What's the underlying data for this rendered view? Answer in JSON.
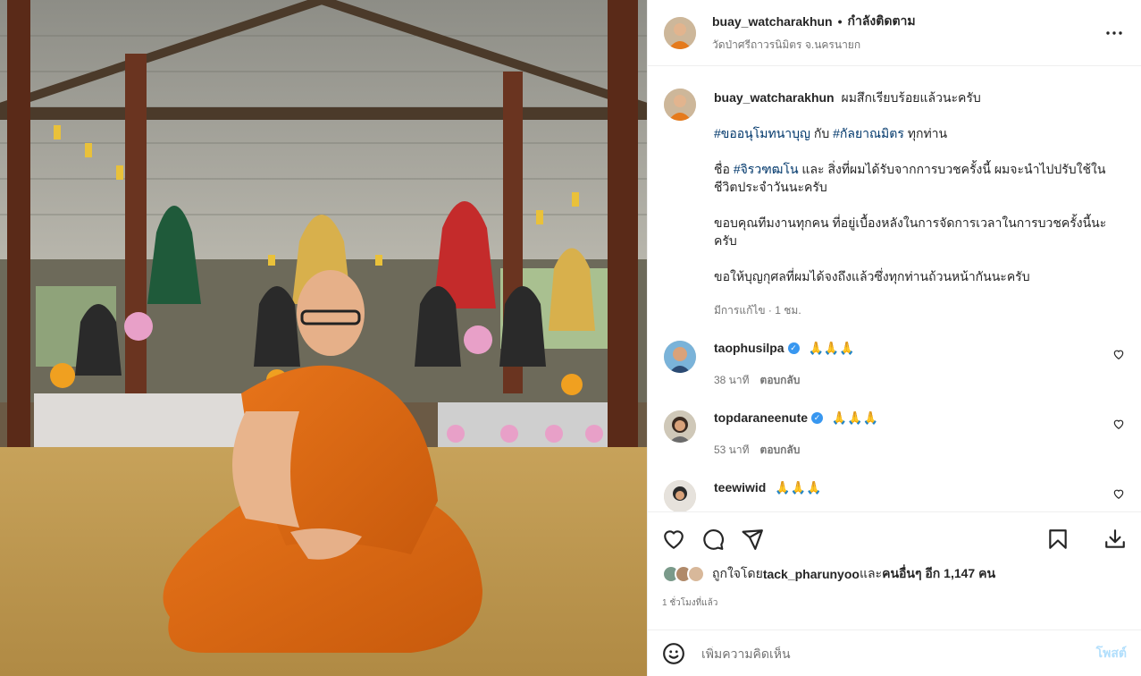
{
  "post": {
    "username": "buay_watcharakhun",
    "separator": "•",
    "follow_status": "กำลังติดตาม",
    "location": "วัดป่าศรีถาวรนิมิตร จ.นครนายก",
    "more_icon": "more-horizontal-icon",
    "photo_alt": "พระภิกษุนั่งในศาลาวัด"
  },
  "caption": {
    "username": "buay_watcharakhun",
    "line1": "ผมสึกเรียบร้อยแล้วนะครับ",
    "para2_tag1": "#ขออนุโมทนาบุญ",
    "para2_mid": " กับ ",
    "para2_tag2": "#กัลยาณมิตร",
    "para2_end": " ทุกท่าน",
    "para3_start": "ชื่อ ",
    "para3_tag": "#จิรวฑฒโน",
    "para3_end": " และ สิ่งที่ผมได้รับจากการบวชครั้งนี้ ผมจะนำไปปรับใช้ในชีวิตประจำวันนะครับ",
    "para4": "ขอบคุณทีมงานทุกคน ที่อยู่เบื้องหลังในการจัดการเวลาในการบวชครั้งนี้นะครับ",
    "para5": "ขอให้บุญกุศลที่ผมได้จงถึงแล้วซึ่งทุกท่านถ้วนหน้ากันนะครับ",
    "edited": "มีการแก้ไข · 1 ชม."
  },
  "comments": [
    {
      "username": "taophusilpa",
      "verified": true,
      "text": "🙏🙏🙏",
      "time": "38 นาที",
      "reply": "ตอบกลับ"
    },
    {
      "username": "topdaraneenute",
      "verified": true,
      "text": "🙏🙏🙏",
      "time": "53 นาที",
      "reply": "ตอบกลับ"
    },
    {
      "username": "teewiwid",
      "verified": false,
      "text": "🙏🙏🙏",
      "time": "",
      "reply": ""
    }
  ],
  "actions": {
    "like_icon": "heart-icon",
    "comment_icon": "comment-icon",
    "share_icon": "send-icon",
    "save_icon": "bookmark-icon",
    "download_icon": "download-icon"
  },
  "likes": {
    "prefix": "ถูกใจโดย ",
    "user": "tack_pharunyoo",
    "mid": " และ ",
    "others": "คนอื่นๆ อีก 1,147 คน"
  },
  "timestamp": "1 ชั่วโมงที่แล้ว",
  "add_comment": {
    "emoji_icon": "emoji-icon",
    "placeholder": "เพิ่มความคิดเห็น",
    "post_label": "โพสต์"
  },
  "colors": {
    "link": "#00376b",
    "muted": "#737373",
    "post_disabled": "#b2dffc",
    "verified": "#3897f0"
  }
}
